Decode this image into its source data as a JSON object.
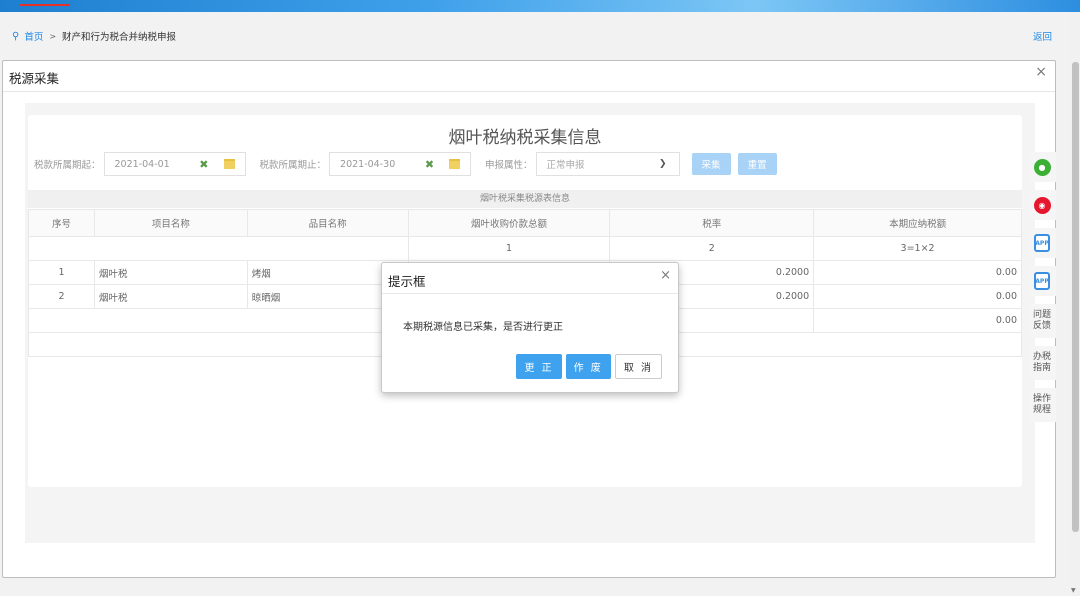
{
  "breadcrumb": {
    "home": "首页",
    "separator": ">",
    "current": "财产和行为税合并纳税申报"
  },
  "back_label": "返回",
  "window": {
    "title": "税源采集",
    "close": "×"
  },
  "panel": {
    "title": "烟叶税纳税采集信息",
    "filters": {
      "start_label": "税款所属期起：",
      "start_value": "2021-04-01",
      "end_label": "税款所属期止：",
      "end_value": "2021-04-30",
      "type_label": "申报属性：",
      "type_value": "正常申报",
      "collect_button": "采集",
      "reset_button": "重置"
    },
    "table_caption": "烟叶税采集税源表信息",
    "columns": [
      "序号",
      "项目名称",
      "品目名称",
      "烟叶收购价款总额",
      "税率",
      "本期应纳税额"
    ],
    "formula_row": [
      "",
      "",
      "",
      "1",
      "2",
      "3=1×2"
    ],
    "rows": [
      {
        "no": "1",
        "project": "烟叶税",
        "item": "烤烟",
        "amount": "",
        "rate": "0.2000",
        "tax": "0.00"
      },
      {
        "no": "2",
        "project": "烟叶税",
        "item": "晾晒烟",
        "amount": "",
        "rate": "0.2000",
        "tax": "0.00"
      }
    ],
    "total_tax": "0.00"
  },
  "side_tools": {
    "feedback": "问题反馈",
    "guide": "办税指南",
    "procedure": "操作规程",
    "app_badge": "APP"
  },
  "dialog": {
    "title": "提示框",
    "close": "×",
    "message": "本期税源信息已采集，是否进行更正",
    "btn_correct": "更 正",
    "btn_void": "作 废",
    "btn_cancel": "取 消"
  },
  "colors": {
    "accent": "#3ea2ef",
    "link": "#1e88e5",
    "wechat": "#3cb034",
    "weibo": "#e6162d"
  }
}
